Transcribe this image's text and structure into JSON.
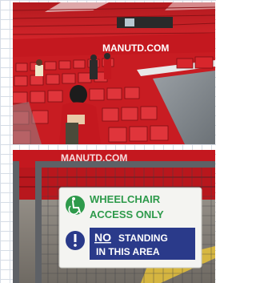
{
  "photos": [
    {
      "id": "stadium-stand",
      "banner_text": "MANUTD.COM"
    },
    {
      "id": "wheelchair-sign",
      "banner_text": "MANUTD.COM",
      "sign": {
        "line1": "WHEELCHAIR",
        "line2": "ACCESS ONLY",
        "notice_word": "NO",
        "notice_rest": "STANDING",
        "notice_line2": "IN THIS AREA",
        "colors": {
          "green": "#2e9a4b",
          "navy": "#2a3a8a"
        }
      }
    }
  ]
}
